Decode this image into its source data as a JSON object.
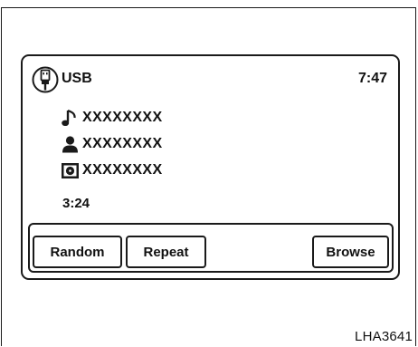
{
  "header": {
    "source": "USB",
    "clock": "7:47",
    "source_icon": "usb-icon"
  },
  "track": {
    "song": "XXXXXXXX",
    "artist": "XXXXXXXX",
    "album": "XXXXXXXX",
    "elapsed": "3:24",
    "icons": [
      "music-note-icon",
      "person-icon",
      "album-icon"
    ]
  },
  "buttons": {
    "random": "Random",
    "repeat": "Repeat",
    "browse": "Browse"
  },
  "figure_id": "LHA3641"
}
